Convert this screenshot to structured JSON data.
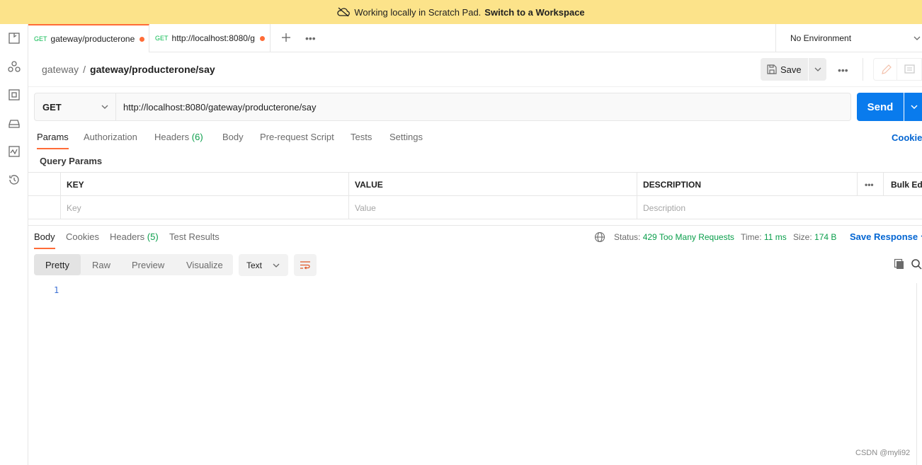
{
  "banner": {
    "text": "Working locally in Scratch Pad.",
    "link": "Switch to a Workspace"
  },
  "tabs": [
    {
      "method": "GET",
      "title": "gateway/producterone"
    },
    {
      "method": "GET",
      "title": "http://localhost:8080/g"
    }
  ],
  "environment": {
    "label": "No Environment"
  },
  "breadcrumb": {
    "parent": "gateway",
    "separator": "/",
    "current": "gateway/producterone/say"
  },
  "header": {
    "save_label": "Save"
  },
  "request": {
    "method": "GET",
    "url": "http://localhost:8080/gateway/producterone/say",
    "send_label": "Send"
  },
  "request_tabs": {
    "params": "Params",
    "authorization": "Authorization",
    "headers": "Headers",
    "headers_count": "(6)",
    "body": "Body",
    "prerequest": "Pre-request Script",
    "tests": "Tests",
    "settings": "Settings",
    "cookies": "Cookies"
  },
  "query_params": {
    "title": "Query Params",
    "columns": {
      "key": "KEY",
      "value": "VALUE",
      "description": "DESCRIPTION",
      "bulk_edit": "Bulk Edi"
    },
    "placeholders": {
      "key": "Key",
      "value": "Value",
      "description": "Description"
    }
  },
  "response_tabs": {
    "body": "Body",
    "cookies": "Cookies",
    "headers": "Headers",
    "headers_count": "(5)",
    "test_results": "Test Results"
  },
  "response_meta": {
    "status_label": "Status:",
    "status_value": "429 Too Many Requests",
    "time_label": "Time:",
    "time_value": "11 ms",
    "size_label": "Size:",
    "size_value": "174 B",
    "save_response": "Save Response"
  },
  "view_modes": {
    "pretty": "Pretty",
    "raw": "Raw",
    "preview": "Preview",
    "visualize": "Visualize",
    "format": "Text"
  },
  "editor": {
    "line_numbers": [
      "1"
    ]
  },
  "watermark": "CSDN @myli92",
  "colors": {
    "accent": "#ff6c37",
    "send": "#097bed",
    "success": "#0a9e4b",
    "banner": "#fce38a",
    "link": "#0265d2"
  }
}
